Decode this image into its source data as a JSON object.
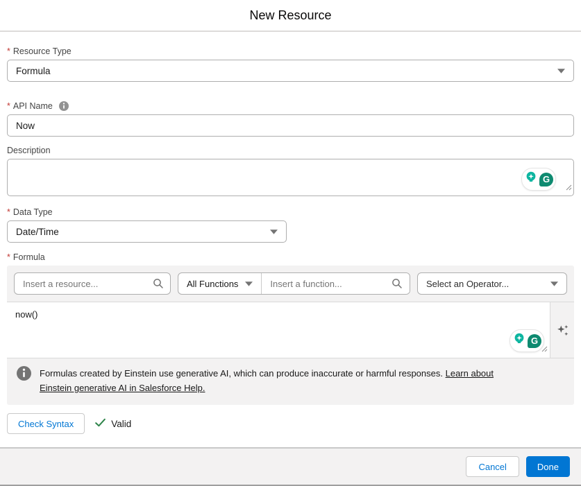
{
  "ui": {
    "required_marker": "*"
  },
  "dialog": {
    "title": "New Resource",
    "resource_type": {
      "label": "Resource Type",
      "value": "Formula"
    },
    "api_name": {
      "label": "API Name",
      "value": "Now"
    },
    "description": {
      "label": "Description",
      "value": ""
    },
    "data_type": {
      "label": "Data Type",
      "value": "Date/Time"
    },
    "formula": {
      "label": "Formula",
      "toolbar": {
        "resource_search_placeholder": "Insert a resource...",
        "function_filter_label": "All Functions",
        "function_search_placeholder": "Insert a function...",
        "operator_placeholder": "Select an Operator..."
      },
      "editor_value": "now()"
    },
    "banner": {
      "text": "Formulas created by Einstein use generative AI, which can produce inaccurate or harmful responses.",
      "link": "Learn about Einstein generative AI in Salesforce Help."
    },
    "syntax": {
      "check_button": "Check Syntax",
      "status": "Valid"
    },
    "footer": {
      "cancel": "Cancel",
      "done": "Done"
    },
    "colors": {
      "accent": "#0176d3",
      "success": "#2e844a",
      "required": "#c23934",
      "grammarly_green": "#0e8a70",
      "einstein_teal": "#0db5a0"
    }
  }
}
